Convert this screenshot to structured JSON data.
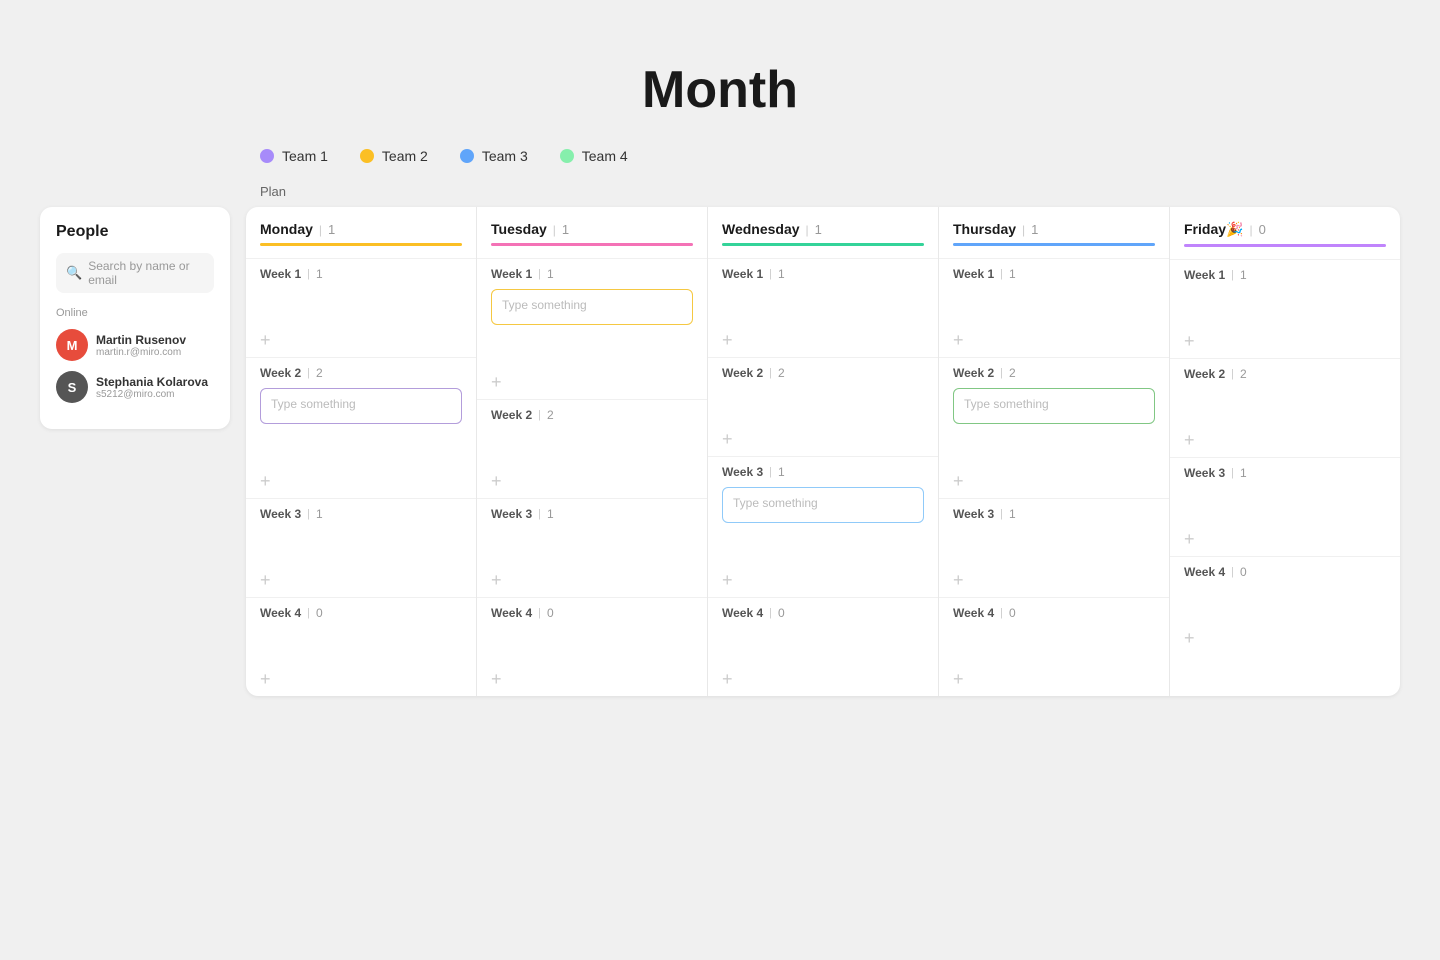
{
  "title": "Month",
  "legend": {
    "items": [
      {
        "label": "Team 1",
        "color": "#a78bfa"
      },
      {
        "label": "Team 2",
        "color": "#fbbf24"
      },
      {
        "label": "Team 3",
        "color": "#60a5fa"
      },
      {
        "label": "Team 4",
        "color": "#86efac"
      }
    ]
  },
  "plan_label": "Plan",
  "people": {
    "title": "People",
    "search_placeholder": "Search by name or email",
    "online_label": "Online",
    "users": [
      {
        "name": "Martin Rusenov",
        "email": "martin.r@miro.com",
        "initials": "M",
        "avatar_class": "avatar-martin"
      },
      {
        "name": "Stephania Kolarova",
        "email": "s5212@miro.com",
        "initials": "S",
        "avatar_class": "avatar-stephania"
      }
    ]
  },
  "days": [
    {
      "name": "Monday",
      "count": 1,
      "bar_color": "#fbbf24",
      "weeks": [
        {
          "label": "Week 1",
          "count": 1,
          "card": null,
          "card_style": null
        },
        {
          "label": "Week 2",
          "count": 2,
          "card": "Type something",
          "card_style": "purple"
        },
        {
          "label": "Week 3",
          "count": 1,
          "card": null,
          "card_style": null
        },
        {
          "label": "Week 4",
          "count": 0,
          "card": null,
          "card_style": null
        }
      ]
    },
    {
      "name": "Tuesday",
      "count": 1,
      "bar_color": "#f472b6",
      "weeks": [
        {
          "label": "Week 1",
          "count": 1,
          "card": "Type something",
          "card_style": "yellow"
        },
        {
          "label": "Week 2",
          "count": 2,
          "card": null,
          "card_style": null
        },
        {
          "label": "Week 3",
          "count": 1,
          "card": null,
          "card_style": null
        },
        {
          "label": "Week 4",
          "count": 0,
          "card": null,
          "card_style": null
        }
      ]
    },
    {
      "name": "Wednesday",
      "count": 1,
      "bar_color": "#34d399",
      "weeks": [
        {
          "label": "Week 1",
          "count": 1,
          "card": null,
          "card_style": null
        },
        {
          "label": "Week 2",
          "count": 2,
          "card": null,
          "card_style": null
        },
        {
          "label": "Week 3",
          "count": 1,
          "card": "Type something",
          "card_style": "blue"
        },
        {
          "label": "Week 4",
          "count": 0,
          "card": null,
          "card_style": null
        }
      ]
    },
    {
      "name": "Thursday",
      "count": 1,
      "bar_color": "#60a5fa",
      "weeks": [
        {
          "label": "Week 1",
          "count": 1,
          "card": null,
          "card_style": null
        },
        {
          "label": "Week 2",
          "count": 2,
          "card": "Type something",
          "card_style": "green"
        },
        {
          "label": "Week 3",
          "count": 1,
          "card": null,
          "card_style": null
        },
        {
          "label": "Week 4",
          "count": 0,
          "card": null,
          "card_style": null
        }
      ]
    },
    {
      "name": "Friday",
      "emoji": "🎉",
      "count": 0,
      "bar_color": "#c084fc",
      "weeks": [
        {
          "label": "Week 1",
          "count": 1,
          "card": null,
          "card_style": null
        },
        {
          "label": "Week 2",
          "count": 2,
          "card": null,
          "card_style": null
        },
        {
          "label": "Week 3",
          "count": 1,
          "card": null,
          "card_style": null
        },
        {
          "label": "Week 4",
          "count": 0,
          "card": null,
          "card_style": null
        }
      ]
    }
  ],
  "add_btn_label": "+",
  "type_placeholder": "Type something"
}
